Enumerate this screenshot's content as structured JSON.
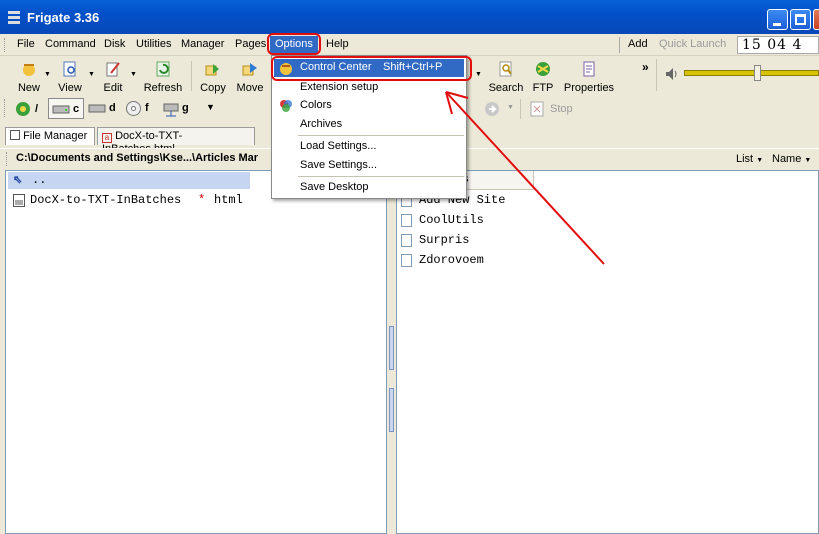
{
  "window": {
    "title": "Frigate 3.36"
  },
  "menubar": {
    "items": [
      "File",
      "Command",
      "Disk",
      "Utilities",
      "Manager",
      "Pages",
      "Options",
      "Help"
    ],
    "add": "Add",
    "quick_launch": "Quick Launch",
    "clock": "15 04 4"
  },
  "toolbar": {
    "new": "New",
    "view": "View",
    "edit": "Edit",
    "refresh": "Refresh",
    "copy": "Copy",
    "move": "Move",
    "search": "Search",
    "ftp": "FTP",
    "properties": "Properties"
  },
  "drives": {
    "root": "/",
    "c": "c",
    "d": "d",
    "f": "f",
    "g": "g",
    "stop": "Stop"
  },
  "tabs": {
    "file_manager": "File Manager",
    "doc": "DocX-to-TXT-InBatches.html"
  },
  "pathbar": {
    "path": "C:\\Documents and Settings\\Kse...\\Articles Mar",
    "list": "List",
    "name": "Name"
  },
  "left_pane": {
    "up": "..",
    "file_name": "DocX-to-TXT-InBatches",
    "file_marker": "*",
    "file_ext": "html"
  },
  "right_pane": {
    "items": [
      "Add New Site",
      "CoolUtils",
      "Surpris",
      "Zdorovoem"
    ],
    "header_fragment": "s"
  },
  "options_menu": {
    "control_center": "Control Center",
    "control_center_shortcut": "Shift+Ctrl+P",
    "extension_setup": "Extension setup",
    "colors": "Colors",
    "archives": "Archives",
    "load_settings": "Load Settings...",
    "save_settings": "Save Settings...",
    "save_desktop": "Save Desktop"
  },
  "colors": {
    "titlebar": "#0250c9",
    "highlight": "#316ac5",
    "annotation": "#e20d0d"
  }
}
